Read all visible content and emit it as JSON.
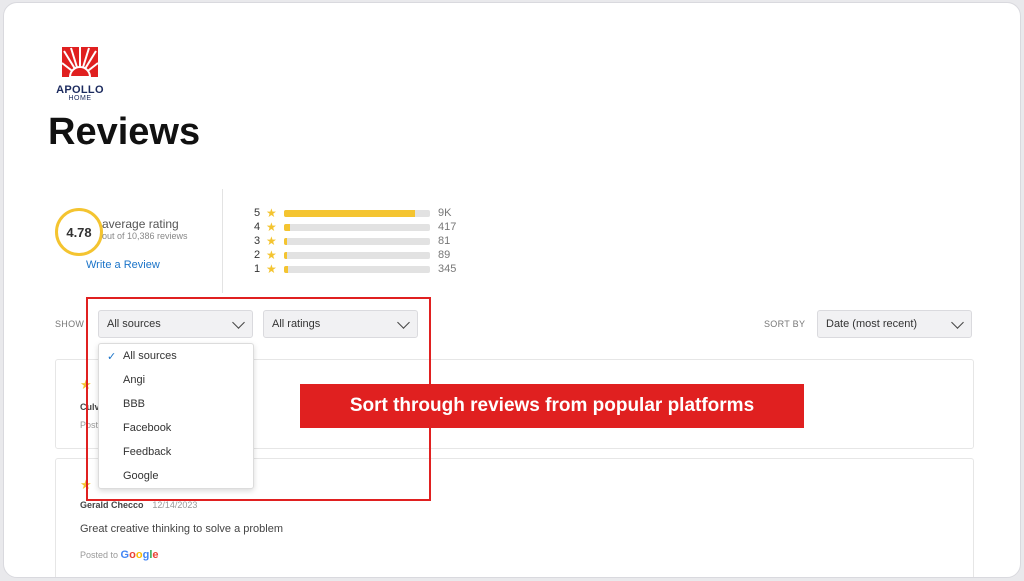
{
  "brand": {
    "logo_text": "APOLLO",
    "logo_sub": "HOME",
    "accent": "#e02020",
    "star_color": "#f4c430",
    "link_color": "#1a73c8"
  },
  "page": {
    "title": "Reviews"
  },
  "summary": {
    "average": "4.78",
    "average_label": "average rating",
    "average_sub": "out of 10,386 reviews",
    "write_review": "Write a Review"
  },
  "distribution": [
    {
      "stars": "5",
      "count": "9K",
      "fraction": 0.9
    },
    {
      "stars": "4",
      "count": "417",
      "fraction": 0.04
    },
    {
      "stars": "3",
      "count": "81",
      "fraction": 0.01
    },
    {
      "stars": "2",
      "count": "89",
      "fraction": 0.01
    },
    {
      "stars": "1",
      "count": "345",
      "fraction": 0.03
    }
  ],
  "filters": {
    "show_label": "SHOW",
    "source_value": "All sources",
    "rating_value": "All ratings",
    "sort_label": "SORT BY",
    "sort_value": "Date (most recent)"
  },
  "source_options": [
    "All sources",
    "Angi",
    "BBB",
    "Facebook",
    "Feedback",
    "Google"
  ],
  "reviews": [
    {
      "reviewer_partial": "Culv",
      "posted_partial": "Post"
    },
    {
      "reviewer": "Gerald Checco",
      "date": "12/14/2023",
      "text": "Great creative thinking to solve a problem",
      "posted_to": "Posted to",
      "platform": "Google"
    }
  ],
  "callout": {
    "text": "Sort through reviews from popular platforms"
  }
}
